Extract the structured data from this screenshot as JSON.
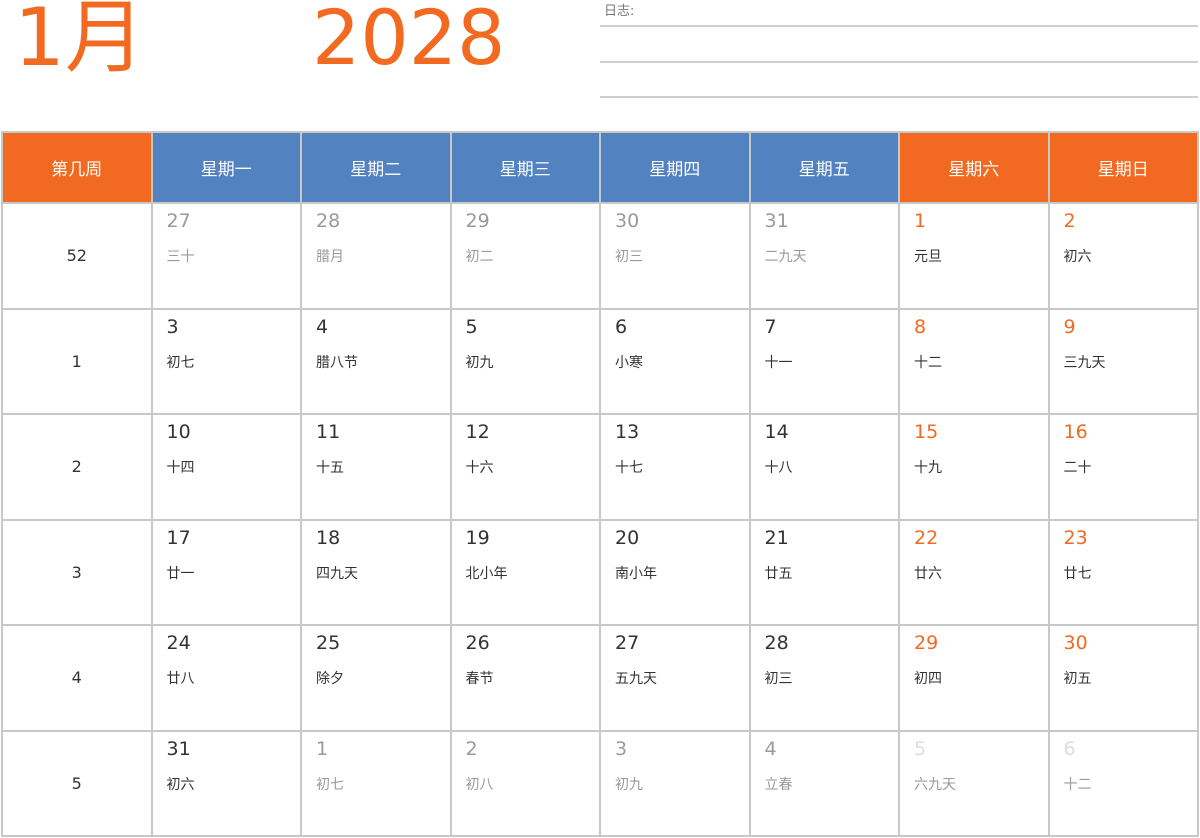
{
  "header": {
    "month": "1月",
    "year": "2028",
    "notes_label": "日志:"
  },
  "colors": {
    "accent": "#f26a21",
    "weekday_header": "#5282c0",
    "grid": "#c8c8c8",
    "muted_text": "#9a9a9a"
  },
  "table": {
    "headers": [
      "第几周",
      "星期一",
      "星期二",
      "星期三",
      "星期四",
      "星期五",
      "星期六",
      "星期日"
    ],
    "weeks": [
      {
        "week": "52",
        "days": [
          {
            "num": "27",
            "lunar": "三十",
            "style": "muted",
            "lunar_style": "muted"
          },
          {
            "num": "28",
            "lunar": "腊月",
            "style": "muted",
            "lunar_style": "muted"
          },
          {
            "num": "29",
            "lunar": "初二",
            "style": "muted",
            "lunar_style": "muted"
          },
          {
            "num": "30",
            "lunar": "初三",
            "style": "muted",
            "lunar_style": "muted"
          },
          {
            "num": "31",
            "lunar": "二九天",
            "style": "muted",
            "lunar_style": "muted"
          },
          {
            "num": "1",
            "lunar": "元旦",
            "style": "orange",
            "lunar_style": ""
          },
          {
            "num": "2",
            "lunar": "初六",
            "style": "orange",
            "lunar_style": ""
          }
        ]
      },
      {
        "week": "1",
        "days": [
          {
            "num": "3",
            "lunar": "初七",
            "style": "",
            "lunar_style": ""
          },
          {
            "num": "4",
            "lunar": "腊八节",
            "style": "",
            "lunar_style": ""
          },
          {
            "num": "5",
            "lunar": "初九",
            "style": "",
            "lunar_style": ""
          },
          {
            "num": "6",
            "lunar": "小寒",
            "style": "",
            "lunar_style": ""
          },
          {
            "num": "7",
            "lunar": "十一",
            "style": "",
            "lunar_style": ""
          },
          {
            "num": "8",
            "lunar": "十二",
            "style": "orange",
            "lunar_style": ""
          },
          {
            "num": "9",
            "lunar": "三九天",
            "style": "orange",
            "lunar_style": ""
          }
        ]
      },
      {
        "week": "2",
        "days": [
          {
            "num": "10",
            "lunar": "十四",
            "style": "",
            "lunar_style": ""
          },
          {
            "num": "11",
            "lunar": "十五",
            "style": "",
            "lunar_style": ""
          },
          {
            "num": "12",
            "lunar": "十六",
            "style": "",
            "lunar_style": ""
          },
          {
            "num": "13",
            "lunar": "十七",
            "style": "",
            "lunar_style": ""
          },
          {
            "num": "14",
            "lunar": "十八",
            "style": "",
            "lunar_style": ""
          },
          {
            "num": "15",
            "lunar": "十九",
            "style": "orange",
            "lunar_style": ""
          },
          {
            "num": "16",
            "lunar": "二十",
            "style": "orange",
            "lunar_style": ""
          }
        ]
      },
      {
        "week": "3",
        "days": [
          {
            "num": "17",
            "lunar": "廿一",
            "style": "",
            "lunar_style": ""
          },
          {
            "num": "18",
            "lunar": "四九天",
            "style": "",
            "lunar_style": ""
          },
          {
            "num": "19",
            "lunar": "北小年",
            "style": "",
            "lunar_style": ""
          },
          {
            "num": "20",
            "lunar": "南小年",
            "style": "",
            "lunar_style": ""
          },
          {
            "num": "21",
            "lunar": "廿五",
            "style": "",
            "lunar_style": ""
          },
          {
            "num": "22",
            "lunar": "廿六",
            "style": "orange",
            "lunar_style": ""
          },
          {
            "num": "23",
            "lunar": "廿七",
            "style": "orange",
            "lunar_style": ""
          }
        ]
      },
      {
        "week": "4",
        "days": [
          {
            "num": "24",
            "lunar": "廿八",
            "style": "",
            "lunar_style": ""
          },
          {
            "num": "25",
            "lunar": "除夕",
            "style": "",
            "lunar_style": ""
          },
          {
            "num": "26",
            "lunar": "春节",
            "style": "",
            "lunar_style": ""
          },
          {
            "num": "27",
            "lunar": "五九天",
            "style": "",
            "lunar_style": ""
          },
          {
            "num": "28",
            "lunar": "初三",
            "style": "",
            "lunar_style": ""
          },
          {
            "num": "29",
            "lunar": "初四",
            "style": "orange",
            "lunar_style": ""
          },
          {
            "num": "30",
            "lunar": "初五",
            "style": "orange",
            "lunar_style": ""
          }
        ]
      },
      {
        "week": "5",
        "days": [
          {
            "num": "31",
            "lunar": "初六",
            "style": "",
            "lunar_style": ""
          },
          {
            "num": "1",
            "lunar": "初七",
            "style": "muted",
            "lunar_style": "muted"
          },
          {
            "num": "2",
            "lunar": "初八",
            "style": "muted",
            "lunar_style": "muted"
          },
          {
            "num": "3",
            "lunar": "初九",
            "style": "muted",
            "lunar_style": "muted"
          },
          {
            "num": "4",
            "lunar": "立春",
            "style": "muted",
            "lunar_style": "muted"
          },
          {
            "num": "5",
            "lunar": "六九天",
            "style": "faint",
            "lunar_style": "muted"
          },
          {
            "num": "6",
            "lunar": "十二",
            "style": "faint",
            "lunar_style": "muted"
          }
        ]
      }
    ]
  }
}
